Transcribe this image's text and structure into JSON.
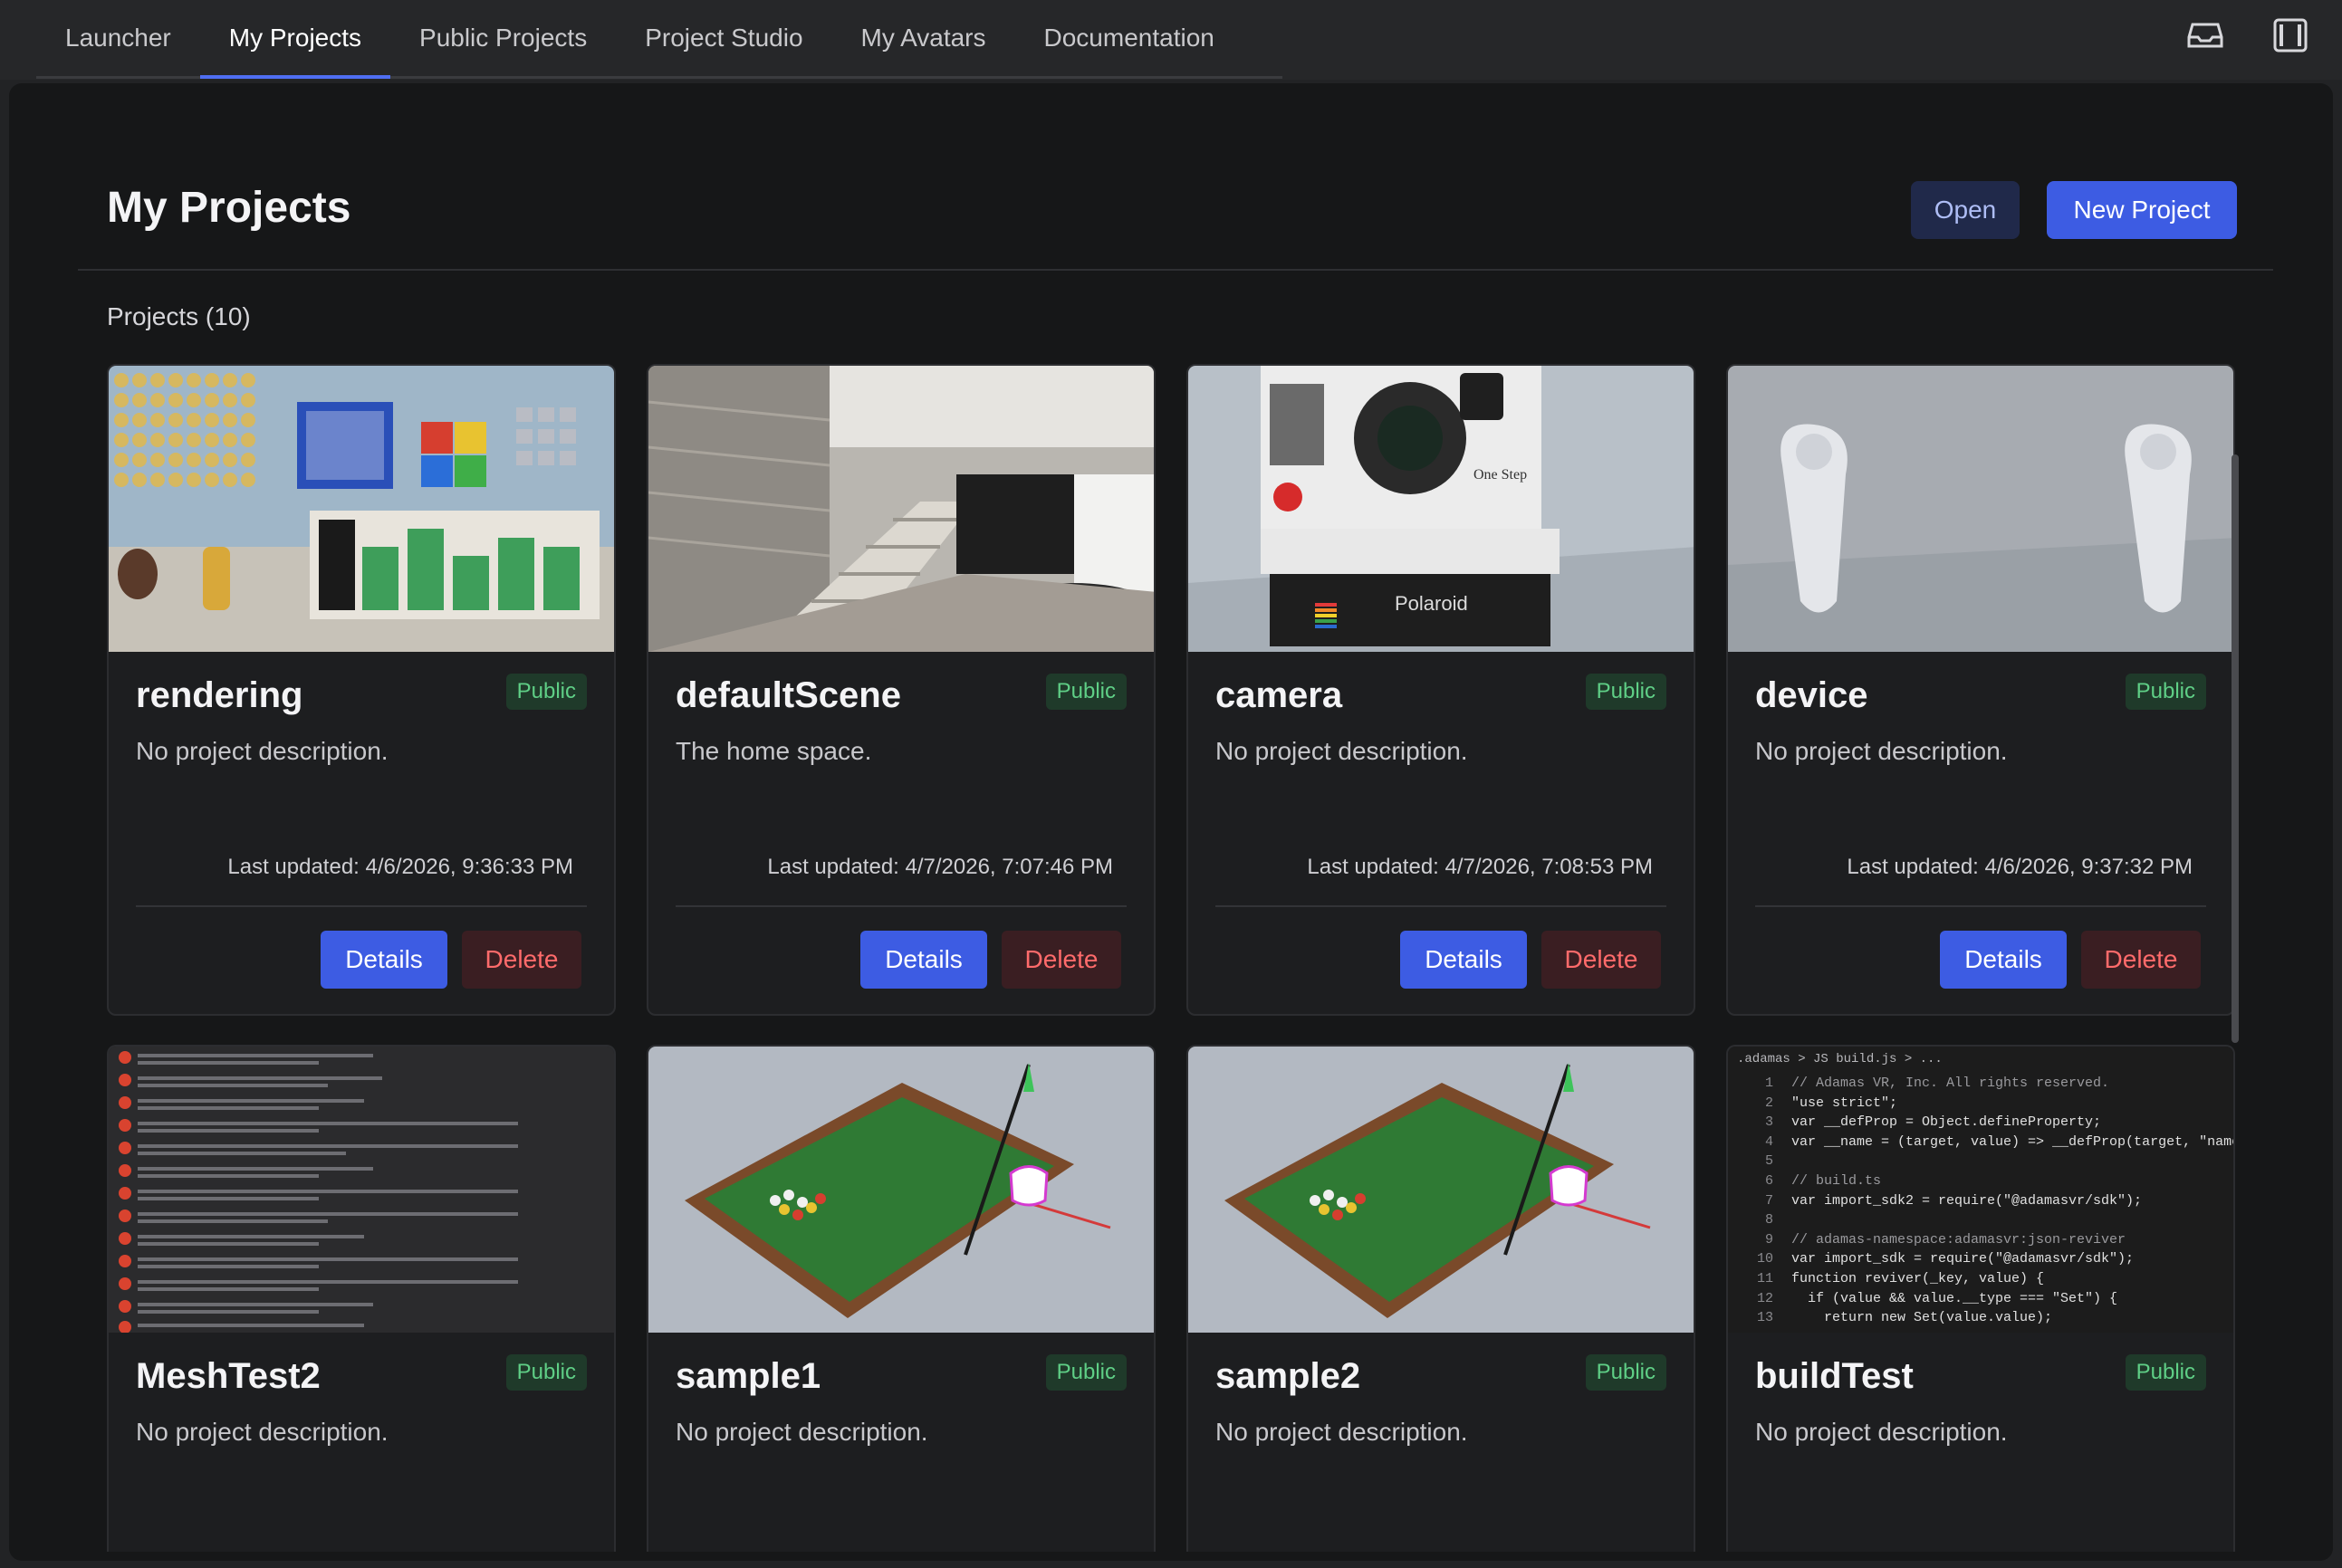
{
  "nav": {
    "tabs": [
      "Launcher",
      "My Projects",
      "Public Projects",
      "Project Studio",
      "My Avatars",
      "Documentation"
    ],
    "active_tab": "My Projects",
    "right_icons": [
      "inbox-icon",
      "window-toggle-icon"
    ]
  },
  "header": {
    "title": "My Projects",
    "open_label": "Open",
    "new_project_label": "New Project"
  },
  "projects_count": "Projects (10)",
  "colors": {
    "accent": "#3d5ce3",
    "public_badge": "#5fcf86",
    "delete": "#ff6b6b",
    "background": "#161718"
  },
  "projects": [
    {
      "name": "rendering",
      "badge": "Public",
      "description": "No project description.",
      "updated": "Last updated: 4/6/2026, 9:36:33 PM",
      "details_label": "Details",
      "delete_label": "Delete"
    },
    {
      "name": "defaultScene",
      "badge": "Public",
      "description": "The home space.",
      "updated": "Last updated: 4/7/2026, 7:07:46 PM",
      "details_label": "Details",
      "delete_label": "Delete"
    },
    {
      "name": "camera",
      "badge": "Public",
      "description": "No project description.",
      "updated": "Last updated: 4/7/2026, 7:08:53 PM",
      "details_label": "Details",
      "delete_label": "Delete",
      "thumb_text_1": "Polaroid",
      "thumb_text_2": "One Step"
    },
    {
      "name": "device",
      "badge": "Public",
      "description": "No project description.",
      "updated": "Last updated: 4/6/2026, 9:37:32 PM",
      "details_label": "Details",
      "delete_label": "Delete"
    },
    {
      "name": "MeshTest2",
      "badge": "Public",
      "description": "No project description."
    },
    {
      "name": "sample1",
      "badge": "Public",
      "description": "No project description."
    },
    {
      "name": "sample2",
      "badge": "Public",
      "description": "No project description."
    },
    {
      "name": "buildTest",
      "badge": "Public",
      "description": "No project description.",
      "code_breadcrumb": ".adamas > JS build.js > ...",
      "code_lines": [
        "// Adamas VR, Inc. All rights reserved.",
        "\"use strict\";",
        "var __defProp = Object.defineProperty;",
        "var __name = (target, value) => __defProp(target, \"name\",",
        "",
        "// build.ts",
        "var import_sdk2 = require(\"@adamasvr/sdk\");",
        "",
        "// adamas-namespace:adamasvr:json-reviver",
        "var import_sdk = require(\"@adamasvr/sdk\");",
        "function reviver(_key, value) {",
        "  if (value && value.__type === \"Set\") {",
        "    return new Set(value.value);"
      ]
    }
  ]
}
